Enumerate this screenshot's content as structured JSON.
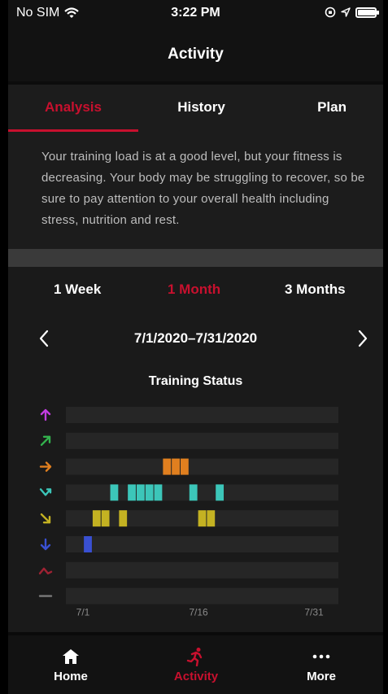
{
  "status_bar": {
    "carrier": "No SIM",
    "time": "3:22 PM"
  },
  "header": {
    "title": "Activity"
  },
  "tabs": [
    {
      "label": "Analysis",
      "active": true
    },
    {
      "label": "History",
      "active": false
    },
    {
      "label": "Plan",
      "active": false
    }
  ],
  "summary": {
    "text": "Your training load is at a good level, but your fitness is decreasing. Your body may be struggling to recover, so be sure to pay attention to your overall health including stress, nutrition and rest."
  },
  "ranges": [
    {
      "label": "1 Week",
      "active": false
    },
    {
      "label": "1 Month",
      "active": true
    },
    {
      "label": "3 Months",
      "active": false
    }
  ],
  "date_nav": {
    "range": "7/1/2020–7/31/2020",
    "prev_icon": "chevron-left-icon",
    "next_icon": "chevron-right-icon"
  },
  "chart_data": {
    "type": "heatmap",
    "title": "Training Status",
    "x_ticks": [
      "7/1",
      "7/16",
      "7/31"
    ],
    "x_range": [
      1,
      31
    ],
    "rows": [
      {
        "icon": "arrow-up-icon",
        "color": "#c23ce0",
        "days": []
      },
      {
        "icon": "arrow-up-right-icon",
        "color": "#33b24d",
        "days": []
      },
      {
        "icon": "arrow-right-icon",
        "color": "#e07f1f",
        "days": [
          12,
          13,
          14
        ]
      },
      {
        "icon": "arrow-zigzag-up-icon",
        "color": "#3cc6b9",
        "days": [
          6,
          8,
          9,
          10,
          11,
          15,
          18
        ]
      },
      {
        "icon": "arrow-down-right-icon",
        "color": "#c4b222",
        "days": [
          4,
          5,
          7,
          16,
          17
        ]
      },
      {
        "icon": "arrow-down-icon",
        "color": "#3950d2",
        "days": [
          3
        ]
      },
      {
        "icon": "arrow-peak-icon",
        "color": "#9e2233",
        "days": []
      },
      {
        "icon": "dash-icon",
        "color": "#7a7a7a",
        "days": []
      }
    ]
  },
  "tabbar": [
    {
      "label": "Home",
      "icon": "home-icon",
      "active": false
    },
    {
      "label": "Activity",
      "icon": "running-icon",
      "active": true
    },
    {
      "label": "More",
      "icon": "more-icon",
      "active": false
    }
  ]
}
